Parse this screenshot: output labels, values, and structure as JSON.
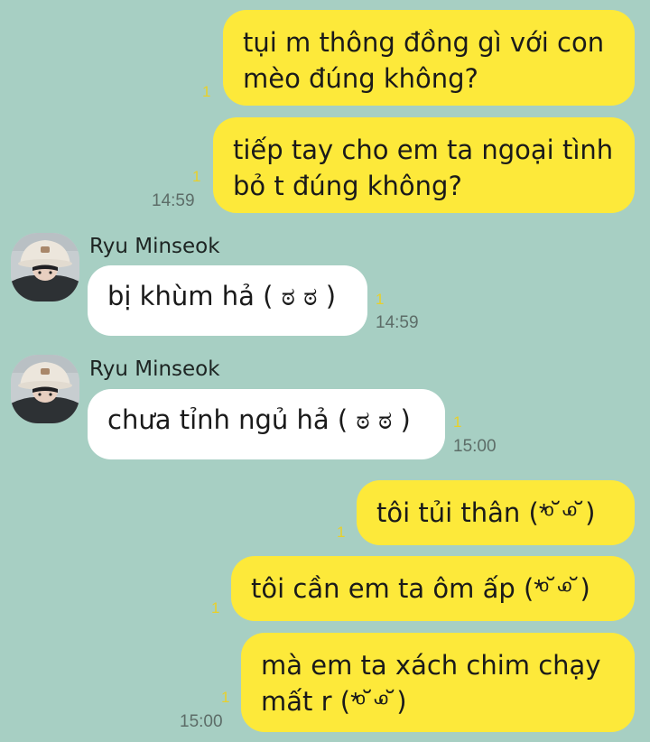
{
  "messages": [
    {
      "id": "m1",
      "side": "me",
      "lines": [
        "tụi m thông đồng gì với con",
        "mèo đúng không?"
      ],
      "unread": "1",
      "time": ""
    },
    {
      "id": "m2",
      "side": "me",
      "lines": [
        "tiếp tay cho em ta ngoại tình",
        "bỏ t đúng không?"
      ],
      "unread": "1",
      "time": "14:59"
    },
    {
      "id": "m3",
      "side": "them",
      "sender": "Ryu Minseok",
      "lines": [
        "bị khùm hả ( ಠ ಠ )"
      ],
      "unread": "1",
      "time": "14:59"
    },
    {
      "id": "m4",
      "side": "them",
      "sender": "Ryu Minseok",
      "lines": [
        "chưa tỉnh ngủ hả ( ಠ ಠ )"
      ],
      "unread": "1",
      "time": "15:00"
    },
    {
      "id": "m5",
      "side": "me",
      "lines": [
        "tôi tủi thân (*ͦ˘ᵕͦ˘)"
      ],
      "unread": "1",
      "time": ""
    },
    {
      "id": "m6",
      "side": "me",
      "lines": [
        "tôi cần em ta ôm ấp (*ͦ˘ᵕͦ˘)"
      ],
      "unread": "1",
      "time": ""
    },
    {
      "id": "m7",
      "side": "me",
      "lines": [
        "mà em ta xách chim chạy",
        "mất r (*ͦ˘ᵕͦ˘)"
      ],
      "unread": "1",
      "time": "15:00"
    }
  ],
  "colors": {
    "background": "#a7cfc3",
    "my_bubble": "#fde93a",
    "their_bubble": "#ffffff",
    "unread": "#e8d02a"
  },
  "icons": {
    "avatar": "profile-avatar"
  }
}
